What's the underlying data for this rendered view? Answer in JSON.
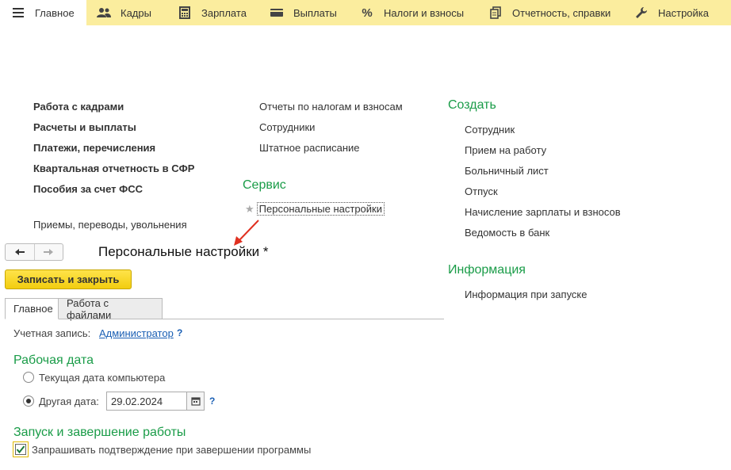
{
  "topbar": {
    "items": [
      {
        "label": "Главное",
        "icon": "hamburger-icon",
        "active": true
      },
      {
        "label": "Кадры",
        "icon": "people-icon"
      },
      {
        "label": "Зарплата",
        "icon": "calculator-icon"
      },
      {
        "label": "Выплаты",
        "icon": "wallet-icon"
      },
      {
        "label": "Налоги и взносы",
        "icon": "percent-icon"
      },
      {
        "label": "Отчетность, справки",
        "icon": "documents-icon"
      },
      {
        "label": "Настройка",
        "icon": "wrench-icon"
      }
    ]
  },
  "main": {
    "col1_bold": [
      "Работа с кадрами",
      "Расчеты и выплаты",
      "Платежи, перечисления",
      "Квартальная отчетность в СФР",
      "Пособия за счет ФСС"
    ],
    "col1_plain": "Приемы, переводы, увольнения",
    "col2": [
      "Отчеты по налогам и взносам",
      "Сотрудники",
      "Штатное расписание"
    ],
    "service": {
      "title": "Сервис",
      "item": "Персональные настройки"
    },
    "create": {
      "title": "Создать",
      "items": [
        "Сотрудник",
        "Прием на работу",
        "Больничный лист",
        "Отпуск",
        "Начисление зарплаты и взносов",
        "Ведомость в банк"
      ]
    },
    "info": {
      "title": "Информация",
      "items": [
        "Информация при запуске"
      ]
    }
  },
  "form": {
    "title": "Персональные настройки *",
    "save_button": "Записать и закрыть",
    "tabs": [
      "Главное",
      "Работа с файлами"
    ],
    "account_label": "Учетная запись:",
    "account_value": "Администратор",
    "help": "?",
    "work_date": {
      "title": "Рабочая дата",
      "option1": "Текущая дата компьютера",
      "option2": "Другая дата:",
      "selected": "option2",
      "date_value": "29.02.2024"
    },
    "startup": {
      "title": "Запуск и завершение работы",
      "confirm_exit": "Запрашивать подтверждение при завершении программы",
      "confirm_exit_checked": true
    }
  },
  "colors": {
    "topbar_bg": "#fbed9e",
    "section_green": "#1a9c48",
    "link_blue": "#1a5fb4",
    "save_button": "#f2cd0f",
    "arrow_red": "#e03020"
  }
}
